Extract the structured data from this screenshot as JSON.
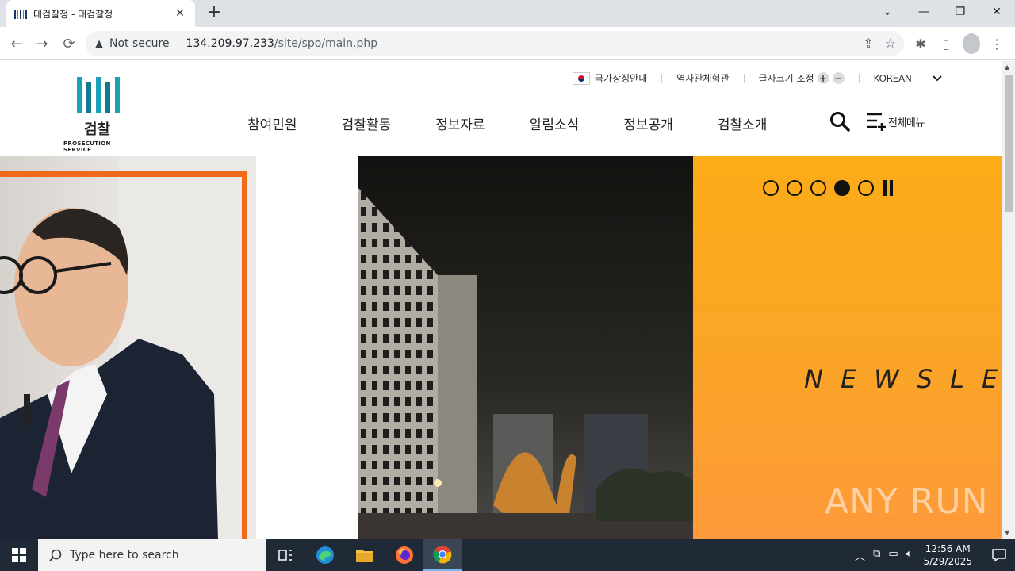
{
  "browser": {
    "tab_title": "대검찰청 - 대검찰청",
    "url_status": "Not secure",
    "url_host": "134.209.97.233",
    "url_path": "/site/spo/main.php"
  },
  "site": {
    "logo_ko": "검찰",
    "logo_en": "PROSECUTION SERVICE",
    "util": {
      "national_symbol": "국가상징안내",
      "history_museum": "역사관체험관",
      "font_size": "글자크기 조정",
      "language": "KOREAN"
    },
    "gnb": [
      "참여민원",
      "검찰활동",
      "정보자료",
      "알림소식",
      "정보공개",
      "검찰소개"
    ],
    "all_menu": "전체메뉴"
  },
  "visual": {
    "slide_count": 5,
    "active_slide": 4,
    "banner_text": "NEWSLE",
    "watermark": "ANY RUN"
  },
  "taskbar": {
    "search_placeholder": "Type here to search",
    "time": "12:56 AM",
    "date": "5/29/2025"
  },
  "colors": {
    "accent_orange": "#f06a1d",
    "panel_yellow": "#fbac17",
    "logo_teal": "#19a2b6"
  }
}
